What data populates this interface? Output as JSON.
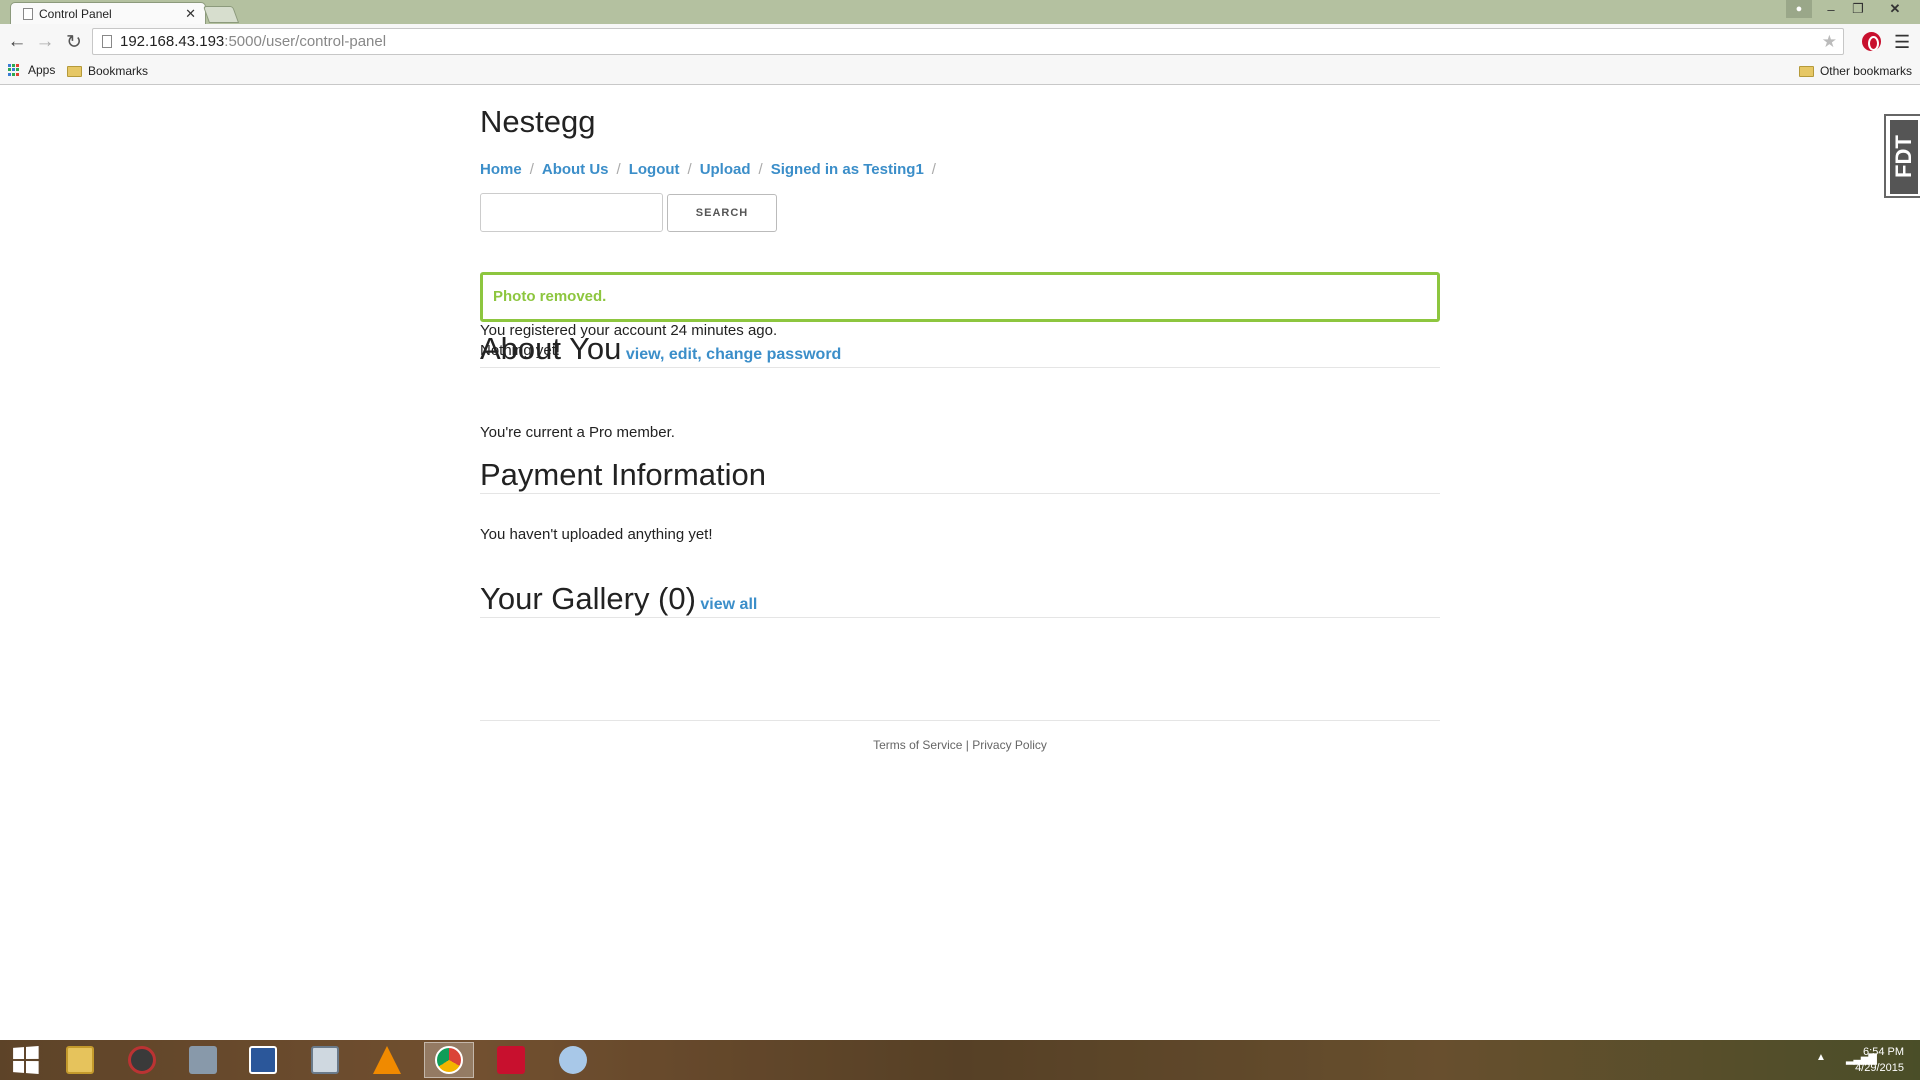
{
  "browser": {
    "tab_title": "Control Panel",
    "url_host": "192.168.43.193",
    "url_path": ":5000/user/control-panel",
    "bookmarks": {
      "apps": "Apps",
      "bookmarks": "Bookmarks",
      "other": "Other bookmarks"
    }
  },
  "site": {
    "title": "Nestegg",
    "nav": [
      "Home",
      "About Us",
      "Logout",
      "Upload",
      "Signed in as Testing1"
    ],
    "search_button": "SEARCH"
  },
  "alert": "Photo removed.",
  "about": {
    "heading": "About You",
    "links": [
      "view",
      "edit",
      "change password"
    ],
    "registered": "You registered your account 24 minutes ago.",
    "status": "Nothing yet!"
  },
  "payment": {
    "heading": "Payment Information",
    "text": "You're current a Pro member."
  },
  "gallery": {
    "heading": "Your Gallery (0)",
    "link": "view all",
    "text": "You haven't uploaded anything yet!"
  },
  "footer": {
    "tos": "Terms of Service",
    "sep": "|",
    "privacy": "Privacy Policy"
  },
  "side_widget": "FDT",
  "taskbar": {
    "icons": [
      "windows-start",
      "file-explorer",
      "app-settings",
      "network-settings",
      "microsoft-word",
      "calculator",
      "vlc-media-player",
      "google-chrome",
      "adobe-reader",
      "paint"
    ],
    "time": "6:54 PM",
    "date": "4/29/2015"
  },
  "colors": {
    "accent_link": "#3b8ec9",
    "alert_green": "#8dc63f",
    "titlebar": "#b4c1a0"
  }
}
